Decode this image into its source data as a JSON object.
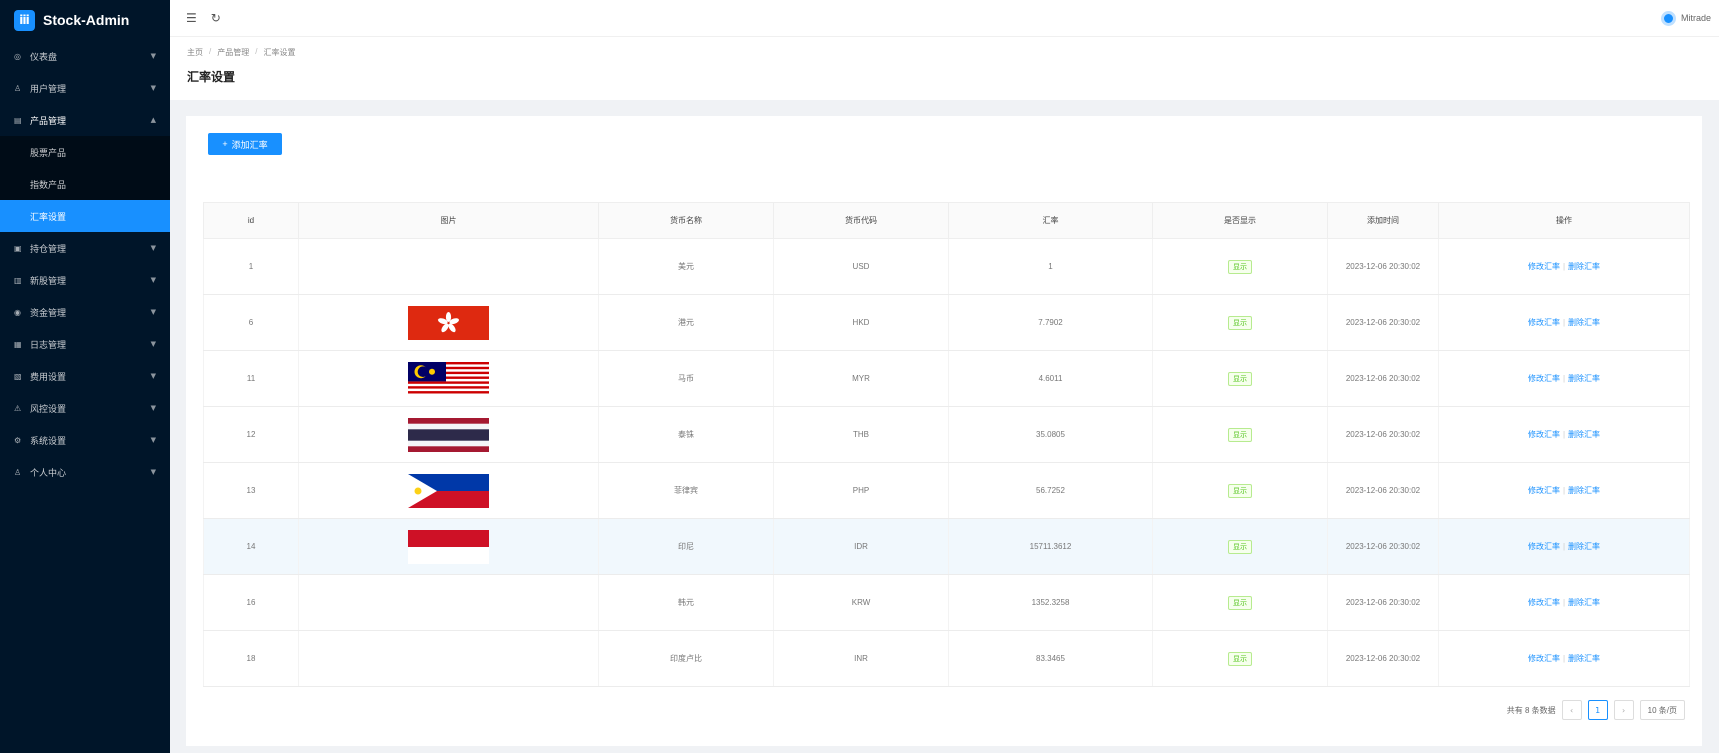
{
  "app": {
    "title": "Stock-Admin",
    "logo_glyph": "ⅲ"
  },
  "sidebar": {
    "items": [
      {
        "label": "仪表盘",
        "icon": "dashboard-icon",
        "glyph": "◎"
      },
      {
        "label": "用户管理",
        "icon": "users-icon",
        "glyph": "♙"
      },
      {
        "label": "产品管理",
        "icon": "chart-icon",
        "glyph": "▤",
        "open": true,
        "children": [
          {
            "label": "股票产品"
          },
          {
            "label": "指数产品"
          },
          {
            "label": "汇率设置",
            "active": true
          }
        ]
      },
      {
        "label": "持仓管理",
        "icon": "clipboard-icon",
        "glyph": "▣"
      },
      {
        "label": "新股管理",
        "icon": "new-stock-icon",
        "glyph": "▥"
      },
      {
        "label": "资金管理",
        "icon": "money-icon",
        "glyph": "◉"
      },
      {
        "label": "日志管理",
        "icon": "log-icon",
        "glyph": "▦"
      },
      {
        "label": "费用设置",
        "icon": "fee-icon",
        "glyph": "▧"
      },
      {
        "label": "风控设置",
        "icon": "warning-icon",
        "glyph": "⚠"
      },
      {
        "label": "系统设置",
        "icon": "settings-icon",
        "glyph": "⚙"
      },
      {
        "label": "个人中心",
        "icon": "user-icon",
        "glyph": "♙"
      }
    ]
  },
  "topbar": {
    "menu_glyph": "☰",
    "refresh_glyph": "↻",
    "username": "Mitrade"
  },
  "breadcrumb": [
    "主页",
    "产品管理",
    "汇率设置"
  ],
  "page_title": "汇率设置",
  "add_button": "添加汇率",
  "table": {
    "headers": [
      "id",
      "图片",
      "货币名称",
      "货币代码",
      "汇率",
      "是否显示",
      "添加时间",
      "操作"
    ],
    "edit_label": "修改汇率",
    "delete_label": "删除汇率",
    "rows": [
      {
        "id": "1",
        "flag": "none",
        "name": "美元",
        "code": "USD",
        "rate": "1",
        "status": "显示",
        "time": "2023-12-06 20:30:02"
      },
      {
        "id": "6",
        "flag": "hk",
        "name": "港元",
        "code": "HKD",
        "rate": "7.7902",
        "status": "显示",
        "time": "2023-12-06 20:30:02"
      },
      {
        "id": "11",
        "flag": "my",
        "name": "马币",
        "code": "MYR",
        "rate": "4.6011",
        "status": "显示",
        "time": "2023-12-06 20:30:02"
      },
      {
        "id": "12",
        "flag": "th",
        "name": "泰铢",
        "code": "THB",
        "rate": "35.0805",
        "status": "显示",
        "time": "2023-12-06 20:30:02"
      },
      {
        "id": "13",
        "flag": "ph",
        "name": "菲律宾",
        "code": "PHP",
        "rate": "56.7252",
        "status": "显示",
        "time": "2023-12-06 20:30:02"
      },
      {
        "id": "14",
        "flag": "id",
        "name": "印尼",
        "code": "IDR",
        "rate": "15711.3612",
        "status": "显示",
        "time": "2023-12-06 20:30:02"
      },
      {
        "id": "16",
        "flag": "none",
        "name": "韩元",
        "code": "KRW",
        "rate": "1352.3258",
        "status": "显示",
        "time": "2023-12-06 20:30:02"
      },
      {
        "id": "18",
        "flag": "none",
        "name": "印度卢比",
        "code": "INR",
        "rate": "83.3465",
        "status": "显示",
        "time": "2023-12-06 20:30:02"
      }
    ]
  },
  "pagination": {
    "total_text": "共有 8 条数据",
    "prev": "‹",
    "current": "1",
    "next": "›",
    "page_size": "10 条/页"
  },
  "colors": {
    "sidebar_bg": "#001529",
    "accent": "#1890ff",
    "status_green": "#52c41a"
  }
}
